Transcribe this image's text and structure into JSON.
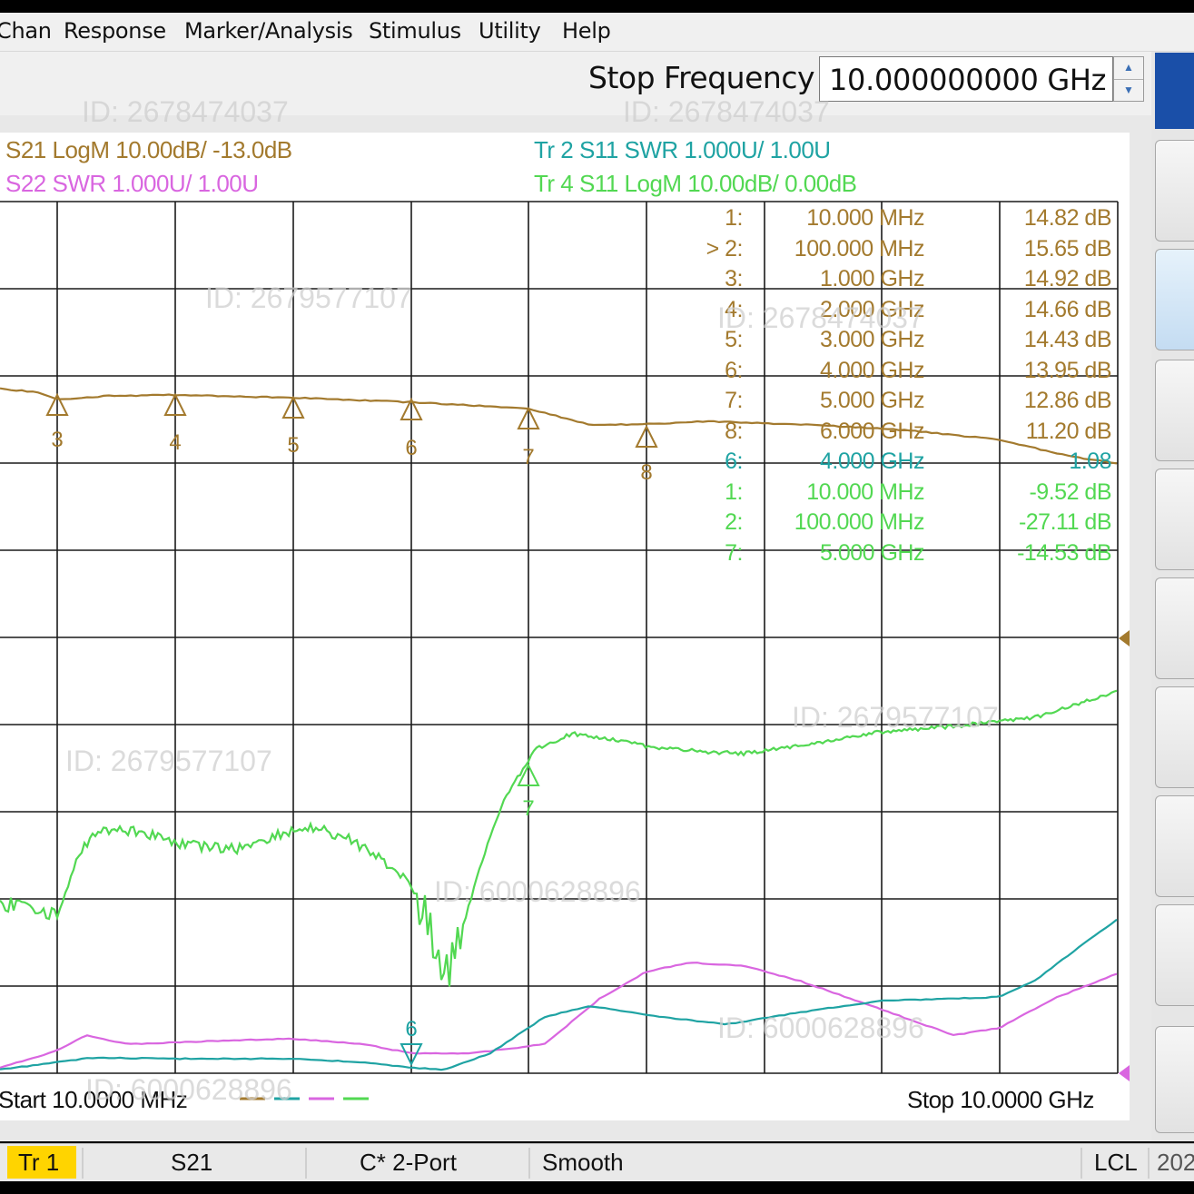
{
  "menu": [
    "Chan",
    "Response",
    "Marker/Analysis",
    "Stimulus",
    "Utility",
    "Help"
  ],
  "entry": {
    "label": "Stop Frequency",
    "value": "10.000000000 GHz",
    "up": "▲",
    "down": "▼"
  },
  "traces": [
    {
      "text": "S21 LogM 10.00dB/  -13.0dB",
      "color": "#a37a2e"
    },
    {
      "text": "S22 SWR 1.000U/  1.00U",
      "color": "#d966e0"
    },
    {
      "text": "Tr  2   S11 SWR 1.000U/  1.00U",
      "color": "#1fa3a3"
    },
    {
      "text": "Tr  4   S11 LogM 10.00dB/  0.00dB",
      "color": "#52d852"
    }
  ],
  "markers": [
    {
      "num": "1:",
      "freq": "10.000 MHz",
      "val": "14.82 dB",
      "color": "#a37a2e"
    },
    {
      "num": "> 2:",
      "freq": "100.000 MHz",
      "val": "15.65 dB",
      "color": "#a37a2e"
    },
    {
      "num": "3:",
      "freq": "1.000 GHz",
      "val": "14.92 dB",
      "color": "#a37a2e"
    },
    {
      "num": "4:",
      "freq": "2.000 GHz",
      "val": "14.66 dB",
      "color": "#a37a2e"
    },
    {
      "num": "5:",
      "freq": "3.000 GHz",
      "val": "14.43 dB",
      "color": "#a37a2e"
    },
    {
      "num": "6:",
      "freq": "4.000 GHz",
      "val": "13.95 dB",
      "color": "#a37a2e"
    },
    {
      "num": "7:",
      "freq": "5.000 GHz",
      "val": "12.86 dB",
      "color": "#a37a2e"
    },
    {
      "num": "8:",
      "freq": "6.000 GHz",
      "val": "11.20 dB",
      "color": "#a37a2e"
    },
    {
      "num": "6:",
      "freq": "4.000 GHz",
      "val": "1.08",
      "color": "#1fa3a3"
    },
    {
      "num": "1:",
      "freq": "10.000 MHz",
      "val": "-9.52 dB",
      "color": "#52d852"
    },
    {
      "num": "2:",
      "freq": "100.000 MHz",
      "val": "-27.11 dB",
      "color": "#52d852"
    },
    {
      "num": "7:",
      "freq": "5.000 GHz",
      "val": "-14.53 dB",
      "color": "#52d852"
    }
  ],
  "axis": {
    "start": "Start  10.0000 MHz",
    "stop": "Stop  10.0000 GHz"
  },
  "status": {
    "trace": "Tr 1",
    "param": "S21",
    "cal": "C* 2-Port",
    "smooth": "Smooth",
    "lcl": "LCL",
    "date": "202"
  },
  "watermarks": [
    "ID: 2678474037",
    "ID: 2678474037",
    "ID:  2679577107",
    "ID: 2678474037",
    "ID:  2679577107",
    "ID:  2679577107",
    "ID: 6000628896",
    "ID: 6000628896",
    "ID: 6000628896"
  ],
  "trace_markers": [
    {
      "label": "3",
      "color": "#a37a2e"
    },
    {
      "label": "4",
      "color": "#a37a2e"
    },
    {
      "label": "5",
      "color": "#a37a2e"
    },
    {
      "label": "6",
      "color": "#a37a2e"
    },
    {
      "label": "7",
      "color": "#a37a2e"
    },
    {
      "label": "8",
      "color": "#a37a2e"
    },
    {
      "label": "7",
      "color": "#52d852"
    },
    {
      "label": "6",
      "color": "#1fa3a3"
    }
  ]
}
